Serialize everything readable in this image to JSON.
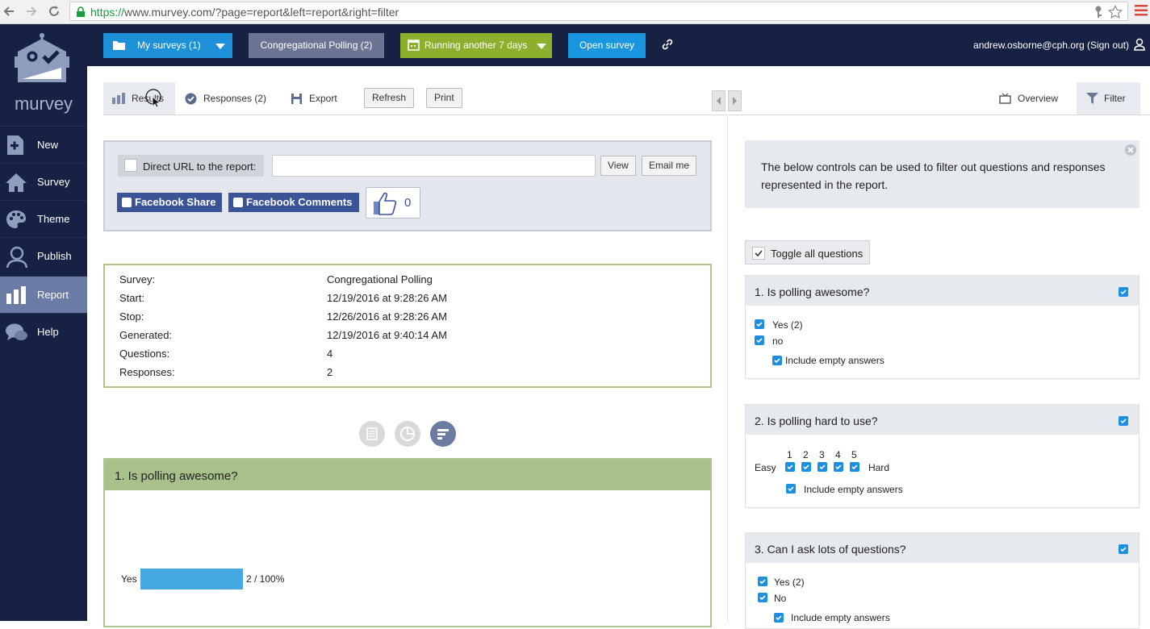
{
  "browser": {
    "url_scheme": "https://",
    "url_rest": "www.murvey.com/?page=report&left=report&right=filter"
  },
  "sidebar": {
    "logo_text": "murvey",
    "items": [
      {
        "label": "New",
        "icon": "plus-doc-icon"
      },
      {
        "label": "Survey",
        "icon": "home-icon"
      },
      {
        "label": "Theme",
        "icon": "palette-icon"
      },
      {
        "label": "Publish",
        "icon": "people-icon"
      },
      {
        "label": "Report",
        "icon": "bar-chart-icon",
        "active": true
      },
      {
        "label": "Help",
        "icon": "chat-bubbles-icon"
      }
    ]
  },
  "topbar": {
    "my_surveys": "My surveys (1)",
    "survey_name": "Congregational Polling (2)",
    "running": "Running another 7 days",
    "open_survey": "Open survey",
    "user": "andrew.osborne@cph.org (Sign out)"
  },
  "toolbar": {
    "tabs": [
      "Results",
      "Responses (2)",
      "Export"
    ],
    "refresh": "Refresh",
    "print": "Print",
    "overview": "Overview",
    "filter": "Filter"
  },
  "share": {
    "direct_url_label": "Direct URL to the report:",
    "view": "View",
    "email_me": "Email me",
    "facebook_share": "Facebook Share",
    "facebook_comments": "Facebook Comments",
    "like_count": "0"
  },
  "info": {
    "rows": [
      {
        "label": "Survey:",
        "value": "Congregational Polling"
      },
      {
        "label": "Start:",
        "value": "12/19/2016 at 9:28:26 AM"
      },
      {
        "label": "Stop:",
        "value": "12/26/2016 at 9:28:26 AM"
      },
      {
        "label": "Generated:",
        "value": "12/19/2016 at 9:40:14 AM"
      },
      {
        "label": "Questions:",
        "value": "4"
      },
      {
        "label": "Responses:",
        "value": "2"
      }
    ]
  },
  "question1": {
    "title": "1.  Is polling awesome?",
    "chart_data": {
      "type": "bar",
      "categories": [
        "Yes"
      ],
      "values": [
        2
      ],
      "percent": [
        100
      ],
      "data_labels": [
        "2 / 100%"
      ]
    }
  },
  "filter": {
    "tip": "The below controls can be used to filter out questions and responses represented in the report.",
    "toggle_all": "Toggle all questions",
    "q1": {
      "title": "1. Is polling awesome?",
      "options": [
        "Yes (2)",
        "no"
      ],
      "empty": "Include empty answers"
    },
    "q2": {
      "title": "2. Is polling hard to use?",
      "left": "Easy",
      "right": "Hard",
      "scale": [
        "1",
        "2",
        "3",
        "4",
        "5"
      ],
      "empty": "Include empty answers"
    },
    "q3": {
      "title": "3. Can I ask lots of questions?",
      "options": [
        "Yes (2)",
        "No"
      ],
      "empty": "Include empty answers"
    }
  },
  "colors": {
    "sidebar_bg": "#172143",
    "active_item": "#6a7ba5",
    "accent_blue": "#1e90d8",
    "running_green": "#8cb02d",
    "card_green": "#a8c18a",
    "facebook": "#3b5498"
  }
}
